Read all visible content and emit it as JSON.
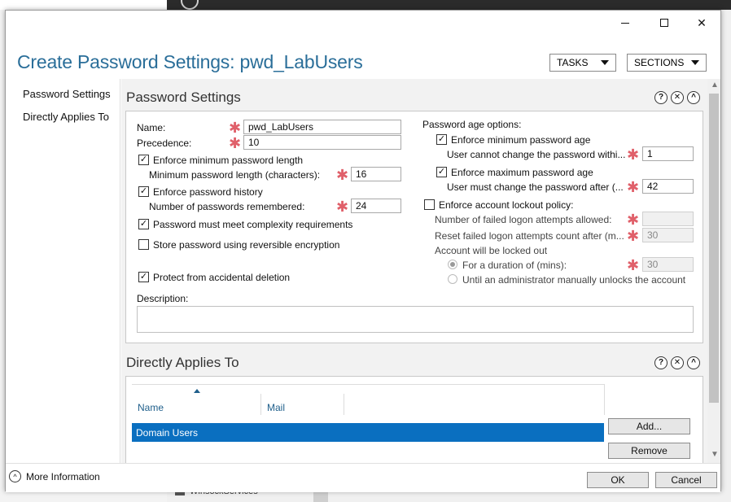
{
  "background": {
    "bottom_item": "WinsockServices"
  },
  "window": {
    "minimize_glyph": "",
    "maximize_glyph": "",
    "close_glyph": "✕"
  },
  "header": {
    "title": "Create Password Settings: pwd_LabUsers",
    "tasks_label": "TASKS",
    "sections_label": "SECTIONS"
  },
  "nav": {
    "items": [
      {
        "label": "Password Settings"
      },
      {
        "label": "Directly Applies To"
      }
    ]
  },
  "password_settings": {
    "title": "Password Settings",
    "icons": {
      "help": "?",
      "close": "✕",
      "collapse": "^"
    },
    "name_label": "Name:",
    "name_value": "pwd_LabUsers",
    "precedence_label": "Precedence:",
    "precedence_value": "10",
    "enforce_min_length_label": "Enforce minimum password length",
    "enforce_min_length_checked": true,
    "min_length_label": "Minimum password length (characters):",
    "min_length_value": "16",
    "enforce_history_label": "Enforce password history",
    "enforce_history_checked": true,
    "history_label": "Number of passwords remembered:",
    "history_value": "24",
    "complexity_label": "Password must meet complexity requirements",
    "complexity_checked": true,
    "reversible_label": "Store password using reversible encryption",
    "reversible_checked": false,
    "protect_label": "Protect from accidental deletion",
    "protect_checked": true,
    "description_label": "Description:",
    "description_value": "",
    "age_options_label": "Password age options:",
    "enforce_min_age_label": "Enforce minimum password age",
    "enforce_min_age_checked": true,
    "min_age_label": "User cannot change the password withi...",
    "min_age_value": "1",
    "enforce_max_age_label": "Enforce maximum password age",
    "enforce_max_age_checked": true,
    "max_age_label": "User must change the password after (...",
    "max_age_value": "42",
    "lockout_label": "Enforce account lockout policy:",
    "lockout_checked": false,
    "failed_attempts_label": "Number of failed logon attempts allowed:",
    "failed_attempts_value": "",
    "reset_count_label": "Reset failed logon attempts count after (m...",
    "reset_count_value": "30",
    "locked_out_label": "Account will be locked out",
    "duration_label": "For a duration of (mins):",
    "duration_value": "30",
    "until_admin_label": "Until an administrator manually unlocks the account"
  },
  "applies_to": {
    "title": "Directly Applies To",
    "icons": {
      "help": "?",
      "close": "✕",
      "collapse": "^"
    },
    "columns": [
      "Name",
      "Mail"
    ],
    "rows": [
      {
        "name": "Domain Users",
        "mail": ""
      }
    ],
    "add_label": "Add...",
    "remove_label": "Remove"
  },
  "footer": {
    "more_info_label": "More Information",
    "ok_label": "OK",
    "cancel_label": "Cancel"
  },
  "colors": {
    "title": "#2a6e99",
    "selection": "#0a6fc0",
    "required": "#e0606a"
  }
}
